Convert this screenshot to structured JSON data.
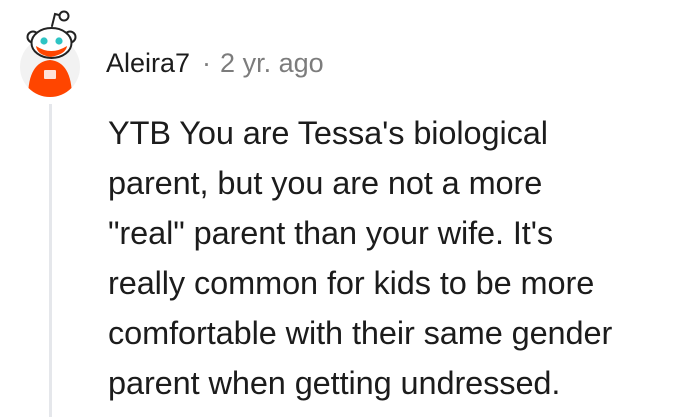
{
  "comment": {
    "author": "Aleira7",
    "separator": "·",
    "timestamp": "2 yr. ago",
    "body_lines": [
      "YTB You are Tessa's biological",
      "parent, but you are not a more",
      "\"real\" parent than your wife. It's",
      "really common for kids to be more",
      "comfortable with their same gender",
      "parent when getting undressed."
    ]
  },
  "avatar": {
    "icon": "snoo-avatar-icon",
    "shirt_color": "#ff4500",
    "face_accent_color": "#2ec4c4"
  }
}
